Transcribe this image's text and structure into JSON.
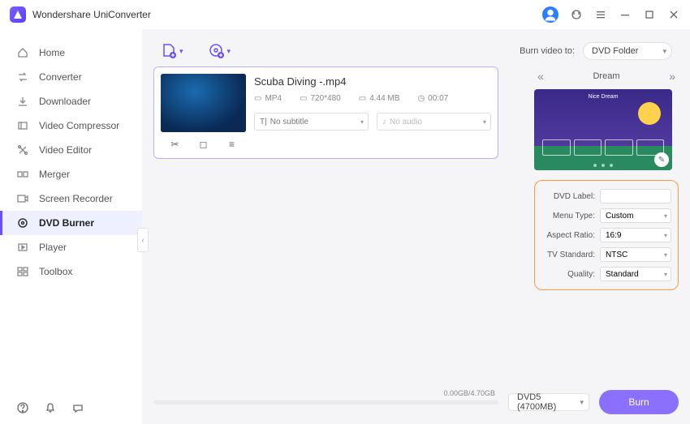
{
  "app": {
    "title": "Wondershare UniConverter"
  },
  "sidebar": {
    "items": [
      {
        "label": "Home",
        "icon": "home-icon"
      },
      {
        "label": "Converter",
        "icon": "converter-icon"
      },
      {
        "label": "Downloader",
        "icon": "downloader-icon"
      },
      {
        "label": "Video Compressor",
        "icon": "compressor-icon"
      },
      {
        "label": "Video Editor",
        "icon": "editor-icon"
      },
      {
        "label": "Merger",
        "icon": "merger-icon"
      },
      {
        "label": "Screen Recorder",
        "icon": "recorder-icon"
      },
      {
        "label": "DVD Burner",
        "icon": "dvd-icon",
        "active": true
      },
      {
        "label": "Player",
        "icon": "player-icon"
      },
      {
        "label": "Toolbox",
        "icon": "toolbox-icon"
      }
    ]
  },
  "toolbar": {
    "burn_to_label": "Burn video to:",
    "burn_to_value": "DVD Folder"
  },
  "file": {
    "title": "Scuba Diving -.mp4",
    "format": "MP4",
    "resolution": "720*480",
    "size": "4.44 MB",
    "duration": "00:07",
    "subtitle": "No subtitle",
    "audio": "No audio"
  },
  "theme": {
    "name": "Dream",
    "preview_title": "Nice Dream"
  },
  "settings": {
    "dvd_label": {
      "label": "DVD Label:",
      "value": ""
    },
    "menu_type": {
      "label": "Menu Type:",
      "value": "Custom"
    },
    "aspect_ratio": {
      "label": "Aspect Ratio:",
      "value": "16:9"
    },
    "tv_standard": {
      "label": "TV Standard:",
      "value": "NTSC"
    },
    "quality": {
      "label": "Quality:",
      "value": "Standard"
    }
  },
  "footer": {
    "progress_text": "0.00GB/4.70GB",
    "disc_type": "DVD5 (4700MB)",
    "burn_label": "Burn"
  }
}
